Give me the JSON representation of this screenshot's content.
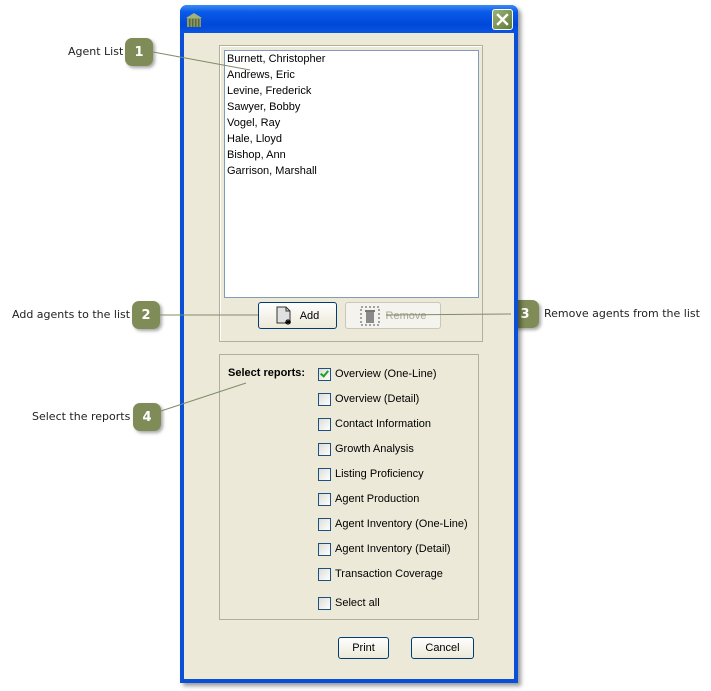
{
  "callouts": [
    {
      "number": "1",
      "label": "Agent List"
    },
    {
      "number": "2",
      "label": "Add agents to the list"
    },
    {
      "number": "3",
      "label": "Remove agents from the list"
    },
    {
      "number": "4",
      "label": "Select the reports"
    }
  ],
  "window": {
    "title": "",
    "icon": "app-building-icon",
    "close_icon": "close-icon"
  },
  "agent_list": {
    "items": [
      "Burnett, Christopher",
      "Andrews, Eric",
      "Levine, Frederick",
      "Sawyer, Bobby",
      "Vogel, Ray",
      "Hale, Lloyd",
      "Bishop, Ann",
      "Garrison, Marshall"
    ]
  },
  "buttons": {
    "add": "Add",
    "remove": "Remove",
    "print": "Print",
    "cancel": "Cancel"
  },
  "reports": {
    "title": "Select reports:",
    "options": [
      {
        "label": "Overview (One-Line)",
        "checked": true
      },
      {
        "label": "Overview (Detail)",
        "checked": false
      },
      {
        "label": "Contact Information",
        "checked": false
      },
      {
        "label": "Growth Analysis",
        "checked": false
      },
      {
        "label": "Listing Proficiency",
        "checked": false
      },
      {
        "label": "Agent Production",
        "checked": false
      },
      {
        "label": "Agent Inventory (One-Line)",
        "checked": false
      },
      {
        "label": "Agent Inventory (Detail)",
        "checked": false
      },
      {
        "label": "Transaction Coverage",
        "checked": false
      }
    ],
    "select_all": {
      "label": "Select all",
      "checked": false
    }
  },
  "colors": {
    "badge": "#7f8c57",
    "titlebar": "#0054e3",
    "dialog_bg": "#ece9d8"
  }
}
